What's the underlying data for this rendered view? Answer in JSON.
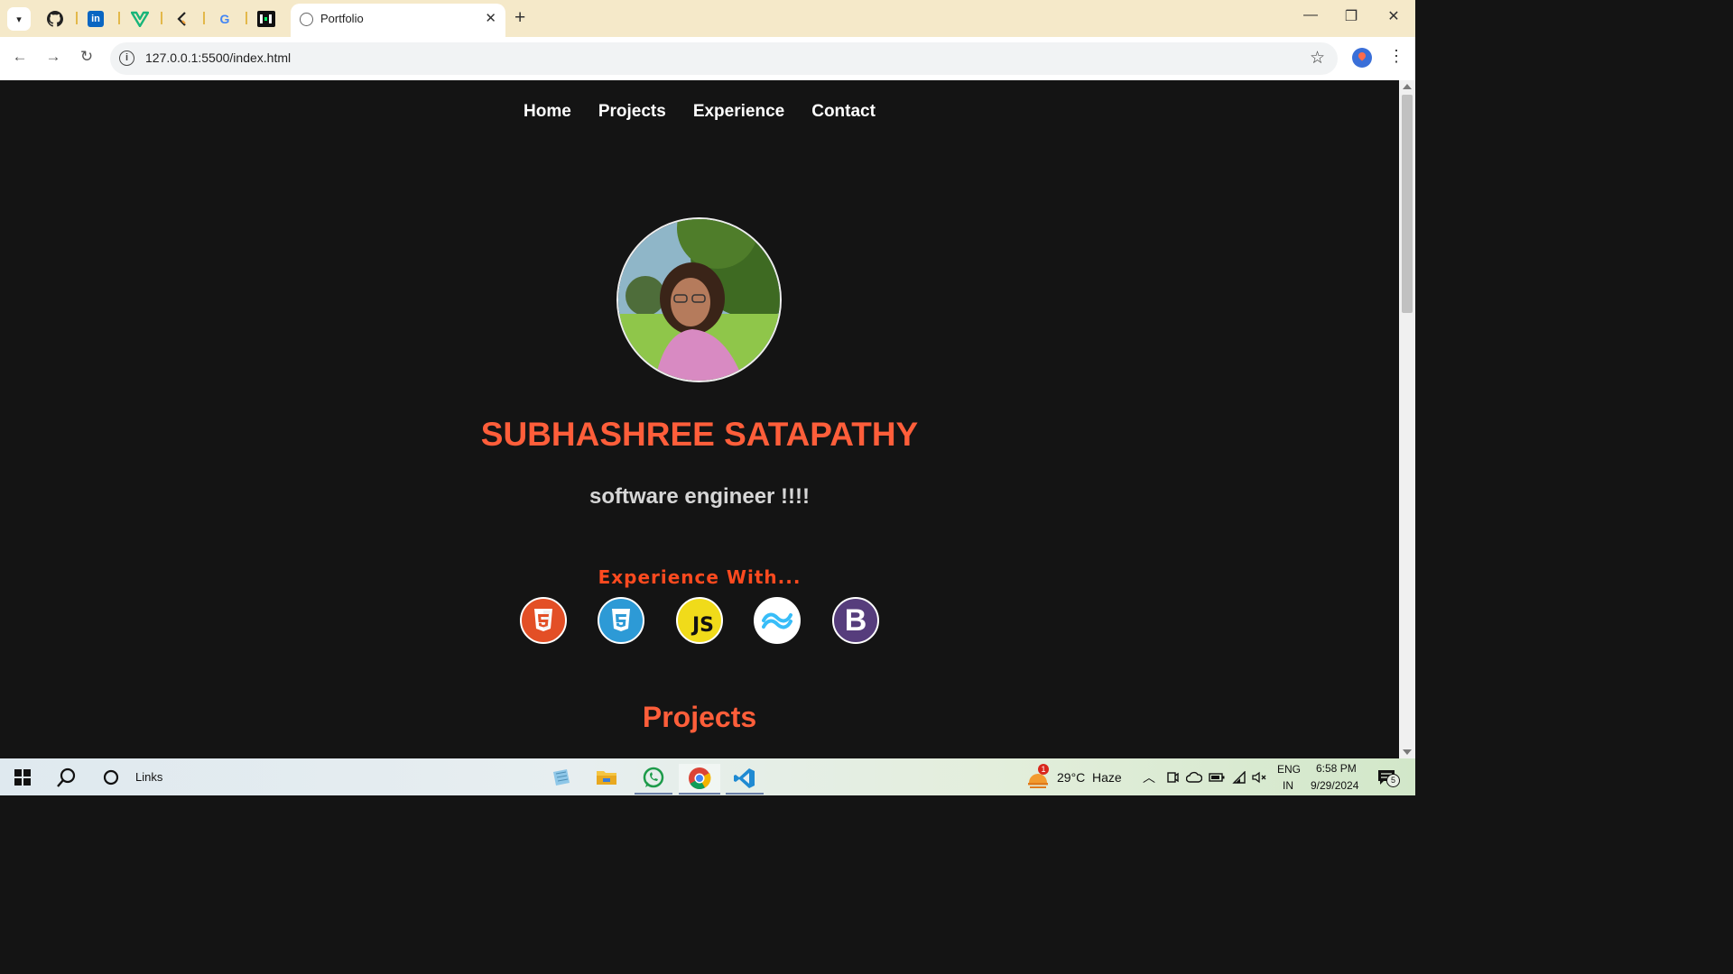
{
  "browser": {
    "tab_title": "Portfolio",
    "address": "127.0.0.1:5500/index.html",
    "pinned_tabs": [
      "github-icon",
      "linkedin-icon",
      "v-logo-icon",
      "bracket-logo-icon",
      "google-icon",
      "hackernoon-icon"
    ]
  },
  "site": {
    "nav": [
      "Home",
      "Projects",
      "Experience",
      "Contact"
    ],
    "name": "SUBHASHREE SATAPATHY",
    "role": "software engineer !!!!",
    "experience_heading": "Experience With...",
    "skills": [
      {
        "icon": "html5-icon",
        "color": "#e34f26"
      },
      {
        "icon": "css3-icon",
        "color": "#2d9ad6"
      },
      {
        "icon": "javascript-icon",
        "color": "#f0db1a",
        "label": "JS"
      },
      {
        "icon": "tailwind-icon",
        "color": "#38bdf8"
      },
      {
        "icon": "bootstrap-icon",
        "color": "#563d7c",
        "label": "B"
      }
    ],
    "projects_heading": "Projects",
    "accent_color": "#ff5e3a"
  },
  "taskbar": {
    "search_label": "Links",
    "weather_temp": "29°C",
    "weather_desc": "Haze",
    "weather_badge": "1",
    "lang_top": "ENG",
    "lang_bottom": "IN",
    "time": "6:58 PM",
    "date": "9/29/2024",
    "notification_count": "5"
  }
}
